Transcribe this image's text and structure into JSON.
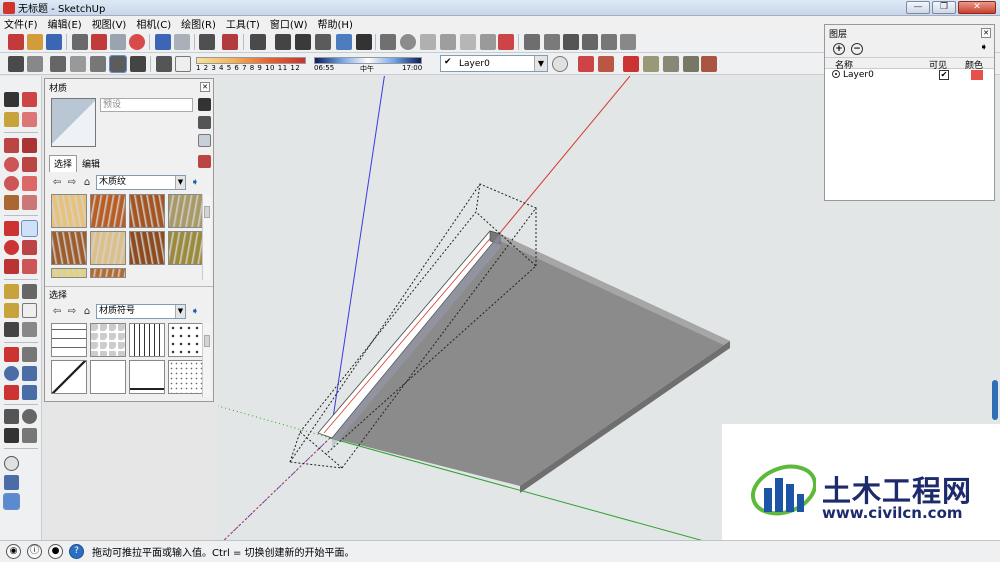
{
  "window": {
    "title": "无标题 - SketchUp",
    "minimize": "—",
    "maximize": "❐",
    "close": "✕"
  },
  "menu": [
    "文件(F)",
    "编辑(E)",
    "视图(V)",
    "相机(C)",
    "绘图(R)",
    "工具(T)",
    "窗口(W)",
    "帮助(H)"
  ],
  "shadow_settings": {
    "month_ticks": "1 2 3 4 5 6 7 8 9 10 11 12",
    "time_start": "06:55",
    "time_mid": "中午",
    "time_end": "17:00"
  },
  "layer_toolbar": {
    "current_layer": "Layer0"
  },
  "materials_panel": {
    "title": "材质",
    "name_placeholder": "预设",
    "tabs": [
      "选择",
      "编辑"
    ],
    "library_1": "木质纹",
    "library_2": "材质符号",
    "section_2_label": "选择",
    "wood_swatches": [
      "#e7c27a",
      "#b85d24",
      "#a35420",
      "#a89a66",
      "#9d5c2c",
      "#dcc08a",
      "#8c4a1d",
      "#9c8a3c",
      "#e3d27c",
      "#b56a2e"
    ],
    "pattern_swatches": [
      "brick",
      "stone",
      "lines",
      "dots",
      "diagonal",
      "blank",
      "hline",
      "speckle"
    ]
  },
  "layers_panel": {
    "title": "图层",
    "col_name": "名称",
    "col_visible": "可见",
    "col_color": "颜色",
    "rows": [
      {
        "name": "Layer0",
        "visible": true,
        "color": "#e8514a"
      }
    ]
  },
  "status_bar": {
    "hint": "拖动可推拉平面或输入值。Ctrl = 切换创建新的开始平面。"
  },
  "watermark": {
    "title": "土木工程网",
    "url": "www.civilcn.com"
  },
  "colors": {
    "axis_red": "#d43b2f",
    "axis_green": "#2ea32e",
    "axis_blue": "#3a3adf",
    "solid_top": "#8a8a8a",
    "solid_side": "#6f6f6f"
  }
}
